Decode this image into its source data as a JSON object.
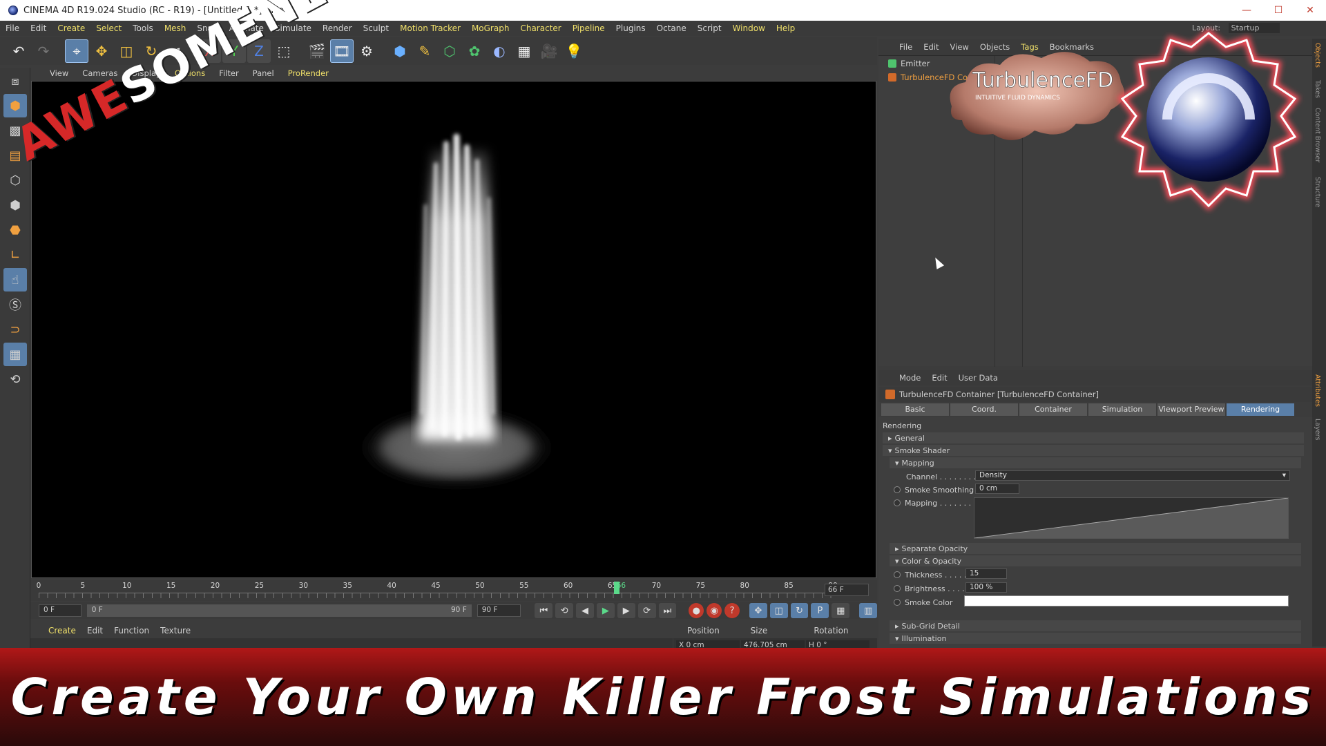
{
  "window": {
    "title": "CINEMA 4D R19.024 Studio (RC - R19) - [Untitled 1 *] - Main",
    "controls": [
      "—",
      "☐",
      "✕"
    ]
  },
  "menubar": {
    "items": [
      "File",
      "Edit",
      "Create",
      "Select",
      "Tools",
      "Mesh",
      "Snap",
      "Animate",
      "Simulate",
      "Render",
      "Sculpt",
      "Motion Tracker",
      "MoGraph",
      "Character",
      "Pipeline",
      "Plugins",
      "Octane",
      "Script",
      "Window",
      "Help"
    ],
    "highlighted": [
      "Create",
      "Select",
      "Mesh",
      "Motion Tracker",
      "MoGraph",
      "Character",
      "Pipeline",
      "Window",
      "Help"
    ]
  },
  "viewport": {
    "menu": [
      "View",
      "Cameras",
      "Display",
      "Options",
      "Filter",
      "Panel",
      "ProRender"
    ]
  },
  "timeline": {
    "ticks": [
      "0",
      "5",
      "10",
      "15",
      "20",
      "25",
      "30",
      "35",
      "40",
      "45",
      "50",
      "55",
      "60",
      "65",
      "66",
      "70",
      "75",
      "80",
      "85",
      "90"
    ],
    "current_frame": "66",
    "end_field": "66 F"
  },
  "transport": {
    "start_field": "0 F",
    "range_start": "0 F",
    "range_end": "90 F",
    "max_field": "90 F"
  },
  "material_manager": {
    "menu": [
      "Create",
      "Edit",
      "Function",
      "Texture"
    ]
  },
  "coordinates": {
    "headers": [
      "Position",
      "Size",
      "Rotation"
    ],
    "values": [
      "X 0 cm",
      "476.705 cm",
      "H 0 °"
    ]
  },
  "object_manager": {
    "menu": [
      "File",
      "Edit",
      "View",
      "Objects",
      "Tags",
      "Bookmarks"
    ],
    "objects": [
      "Emitter",
      "TurbulenceFD Co"
    ]
  },
  "right_tabs": [
    "Objects",
    "Takes",
    "Content Browser",
    "Structure",
    "Attributes",
    "Layers"
  ],
  "layout": {
    "label": "Layout:",
    "value": "Startup"
  },
  "attributes": {
    "menu": [
      "Mode",
      "Edit",
      "User Data"
    ],
    "title": "TurbulenceFD Container [TurbulenceFD Container]",
    "tabs": [
      "Basic",
      "Coord.",
      "Container",
      "Simulation",
      "Viewport Preview",
      "Rendering"
    ],
    "active_tab": "Rendering",
    "section_heading": "Rendering",
    "groups": {
      "general": "General",
      "smoke_shader": "Smoke Shader",
      "mapping": "Mapping",
      "separate_opacity": "Separate Opacity",
      "color_opacity": "Color & Opacity",
      "sub_grid": "Sub-Grid Detail",
      "illumination": "Illumination"
    },
    "fields": {
      "channel_label": "Channel . . . . . . . .",
      "channel_value": "Density",
      "smoothing_label": "Smoke Smoothing",
      "smoothing_value": "0 cm",
      "mapping_label": "Mapping . . . . . . .",
      "thickness_label": "Thickness . . . . .",
      "thickness_value": "15",
      "brightness_label": "Brightness . . . .",
      "brightness_value": "100 %",
      "smoke_color_label": "Smoke Color"
    }
  },
  "overlay": {
    "watermark": "AWESOMENESS",
    "plugin_logo": "TurbulenceFD",
    "plugin_tagline": "INTUITIVE FLUID DYNAMICS",
    "banner": "Create Your Own Killer Frost Simulations"
  },
  "colors": {
    "accent": "#5a7fa8",
    "highlight_text": "#f0e06a",
    "banner_red": "#b01818",
    "playhead": "#5bd98a"
  }
}
